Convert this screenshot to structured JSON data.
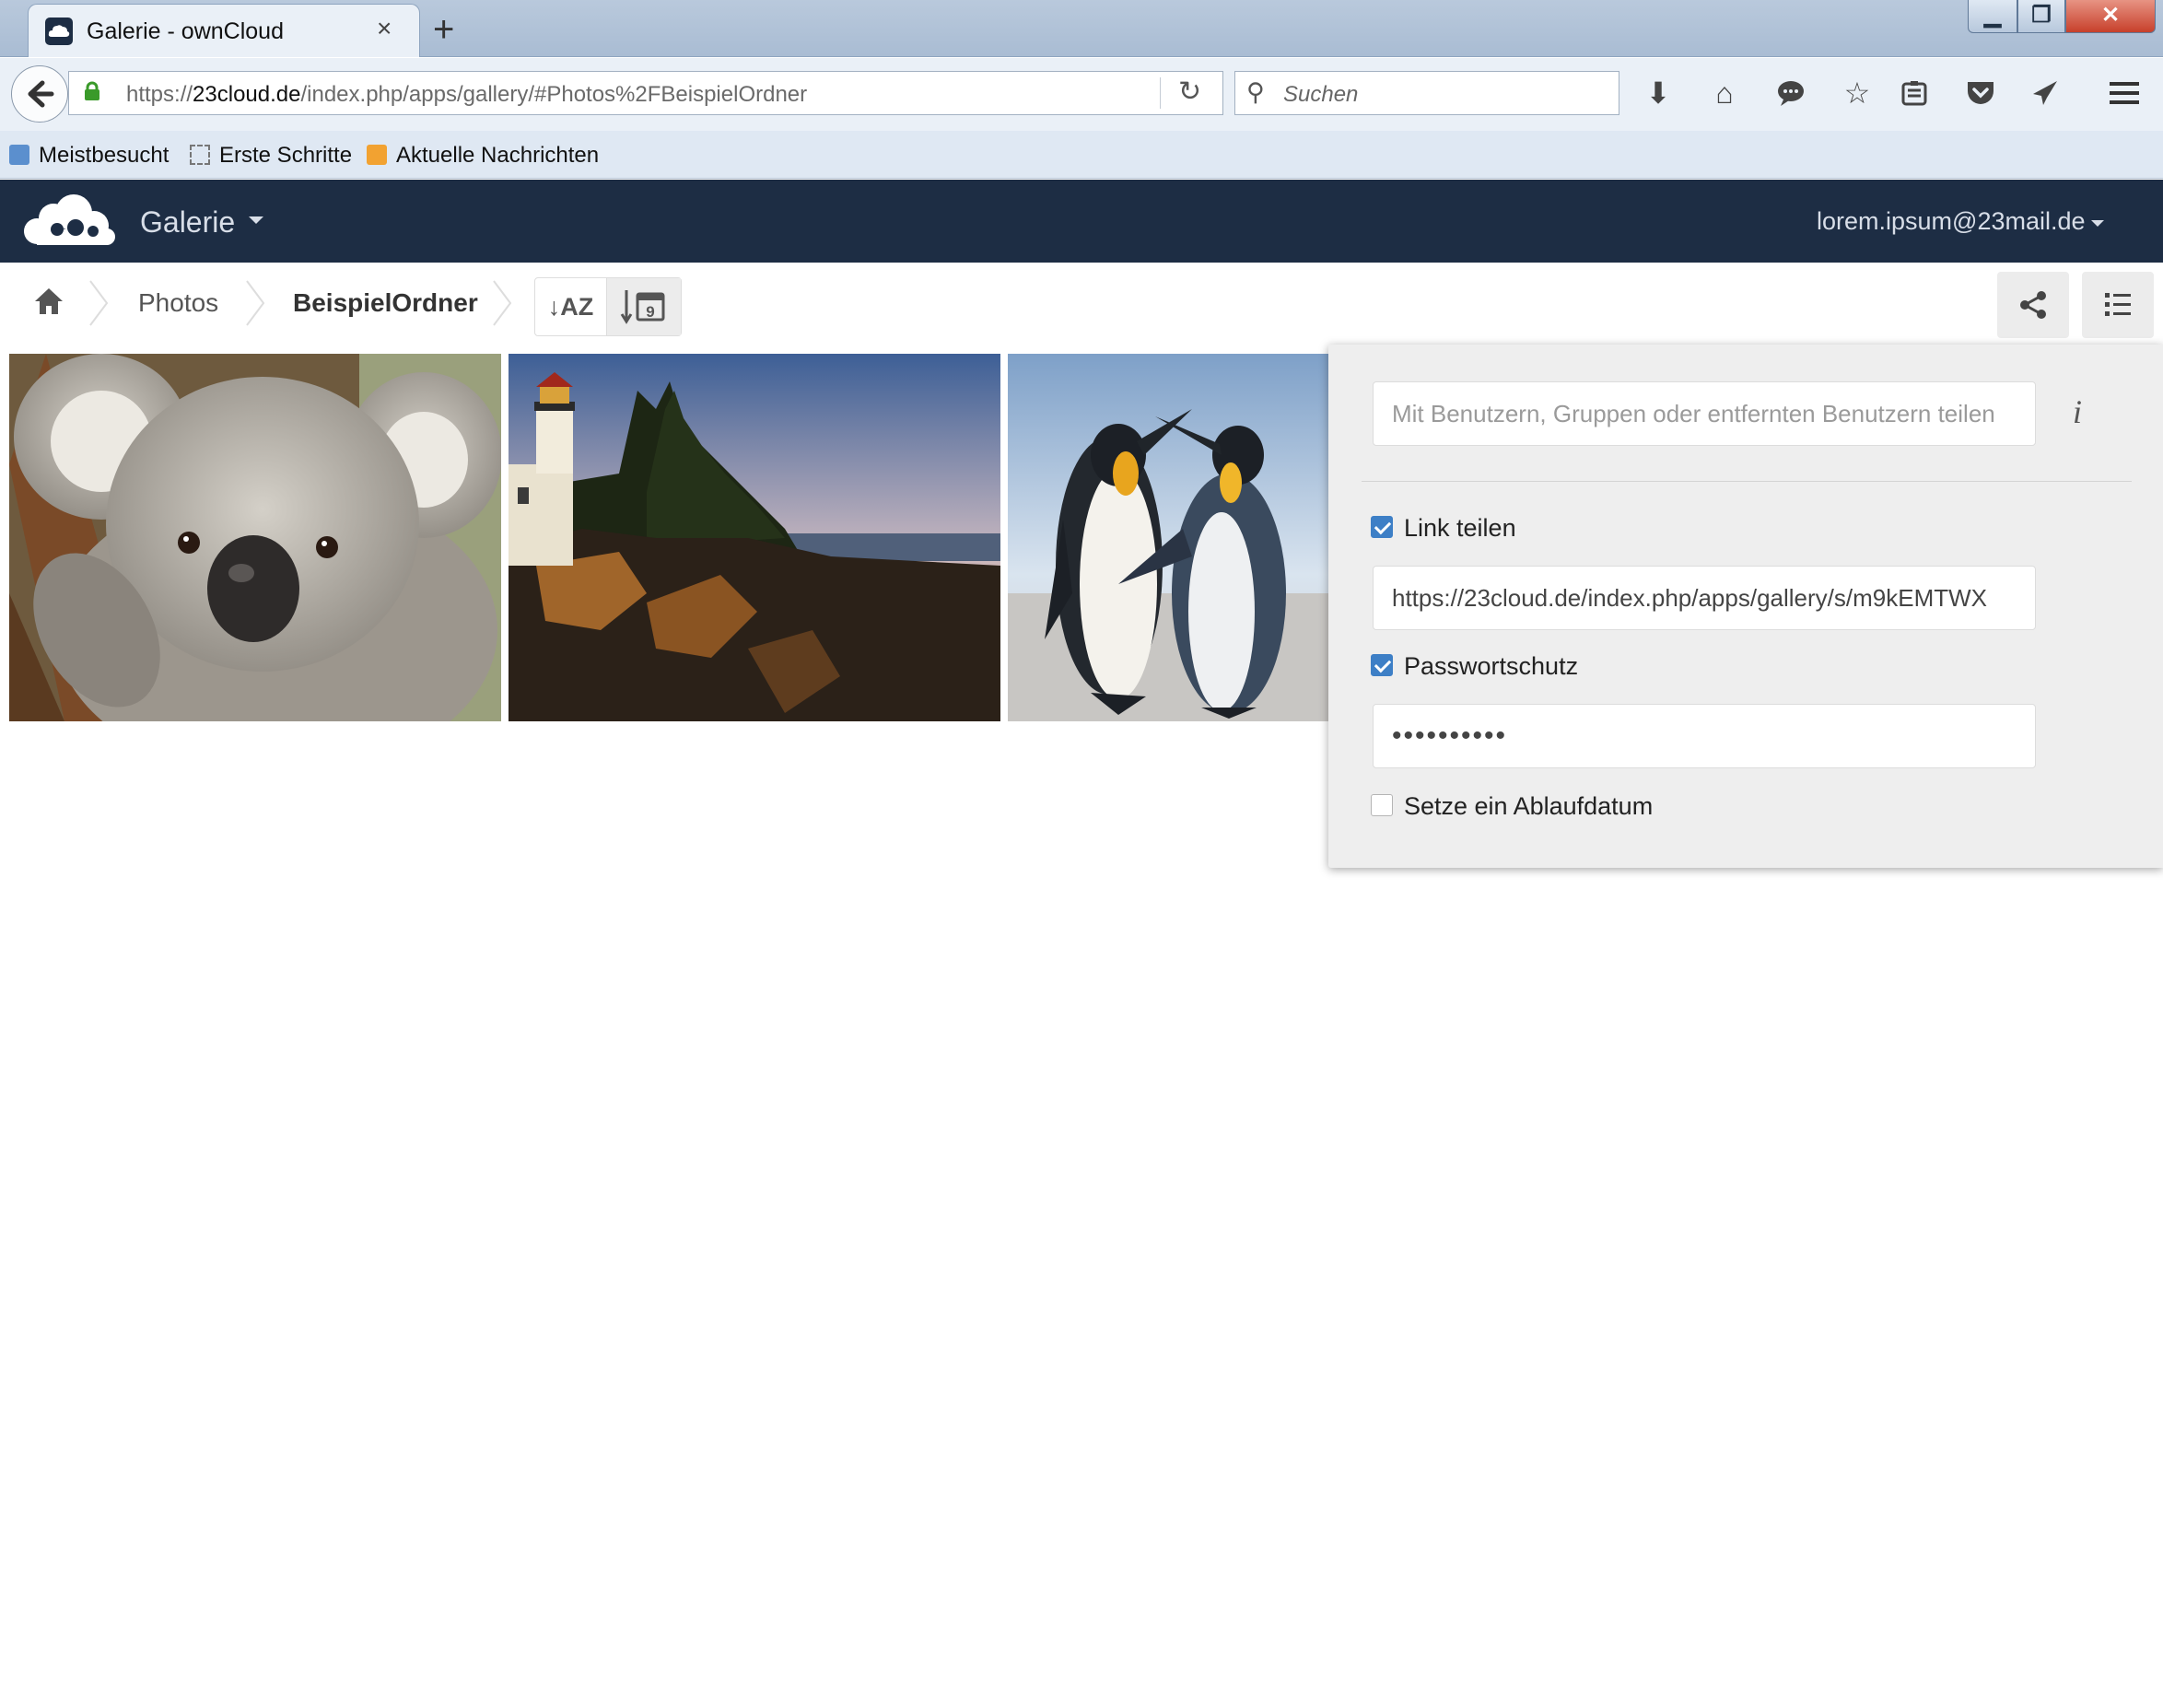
{
  "browser": {
    "tab_title": "Galerie - ownCloud",
    "tab_close": "×",
    "new_tab": "+",
    "window_buttons": {
      "minimize": "▁",
      "restore": "❐",
      "close": "✕"
    },
    "url_prefix": "https://",
    "url_domain": "23cloud.de",
    "url_path": "/index.php/apps/gallery/#Photos%2FBeispielOrdner",
    "search_placeholder": "Suchen",
    "bookmarks": [
      "Meistbesucht",
      "Erste Schritte",
      "Aktuelle Nachrichten"
    ],
    "toolbar_icons": [
      "download-icon",
      "home-icon",
      "chat-icon",
      "bookmark-star-icon",
      "reading-list-icon",
      "pocket-icon",
      "send-icon",
      "hamburger-menu-icon"
    ]
  },
  "app": {
    "name": "Galerie",
    "user": "lorem.ipsum@23mail.de",
    "brand_color": "#1d2d44"
  },
  "breadcrumb": [
    "Photos",
    "BeispielOrdner"
  ],
  "sort": {
    "by_name": "AZ",
    "by_date": "9"
  },
  "gallery": {
    "photos": [
      {
        "name": "koala"
      },
      {
        "name": "lighthouse"
      },
      {
        "name": "penguins"
      }
    ]
  },
  "share_panel": {
    "share_with_placeholder": "Mit Benutzern, Gruppen oder entfernten Benutzern teilen",
    "info_icon": "i",
    "link_share_label": "Link teilen",
    "link_share_checked": true,
    "link_url": "https://23cloud.de/index.php/apps/gallery/s/m9kEMTWX",
    "password_label": "Passwortschutz",
    "password_checked": true,
    "password_value": "••••••••••",
    "expiry_label": "Setze ein Ablaufdatum",
    "expiry_checked": false
  }
}
